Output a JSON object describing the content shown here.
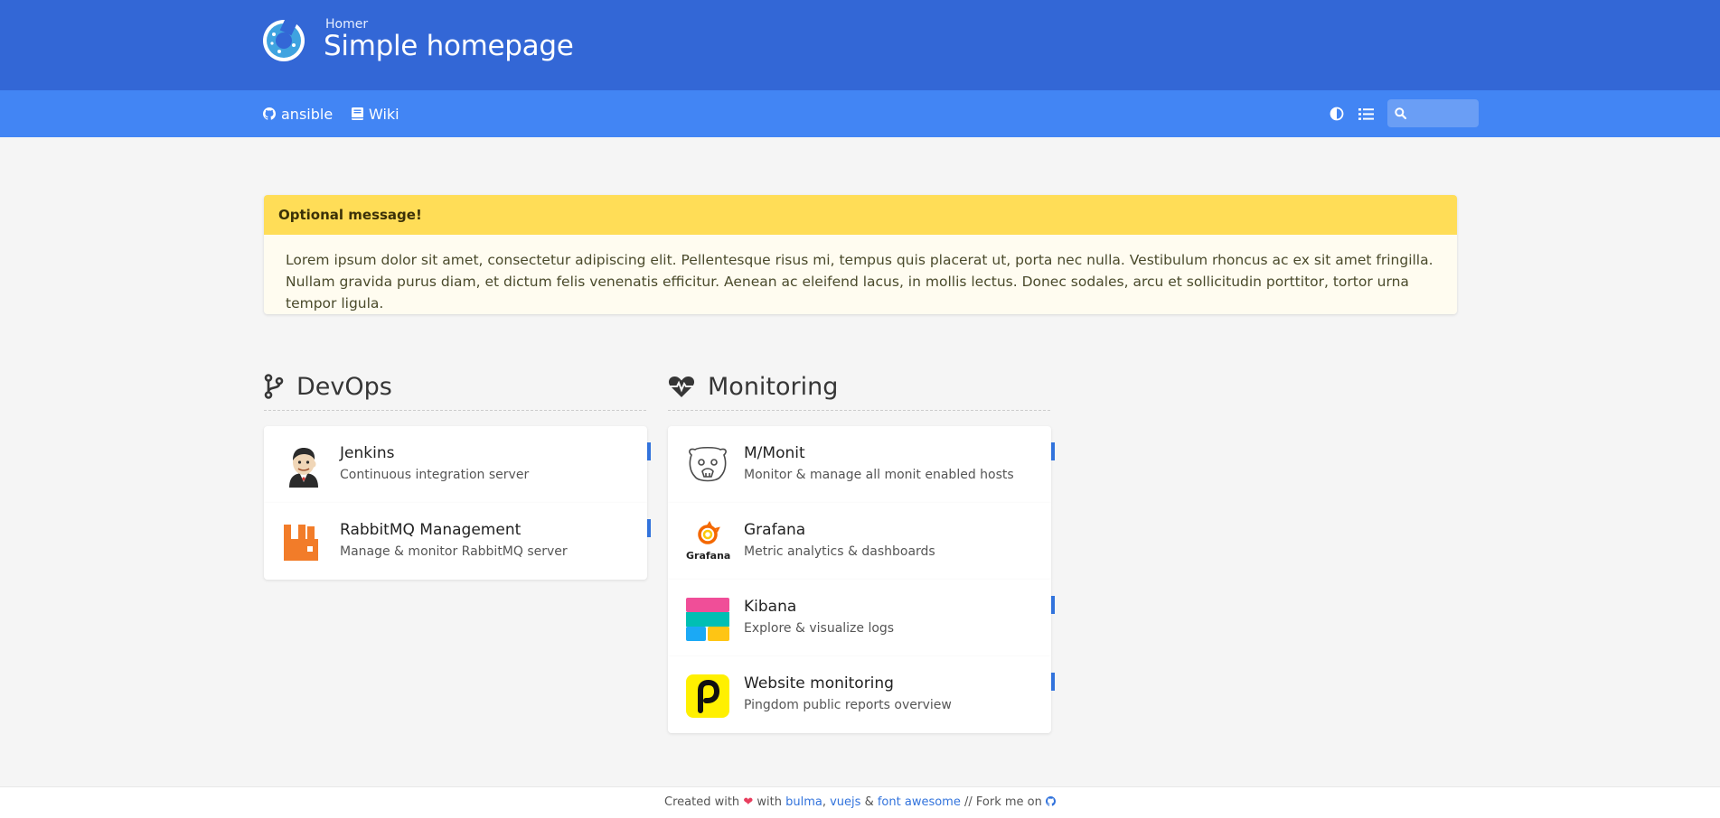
{
  "header": {
    "subtitle": "Homer",
    "title": "Simple homepage"
  },
  "navbar": {
    "links": [
      {
        "label": "ansible",
        "icon": "github-icon"
      },
      {
        "label": "Wiki",
        "icon": "book-icon"
      }
    ],
    "tools": {
      "theme_icon": "contrast-icon",
      "layout_icon": "list-icon"
    },
    "search": {
      "icon": "search-icon",
      "value": "",
      "placeholder": ""
    }
  },
  "message": {
    "title": "Optional message!",
    "body": "Lorem ipsum dolor sit amet, consectetur adipiscing elit. Pellentesque risus mi, tempus quis placerat ut, porta nec nulla. Vestibulum rhoncus ac ex sit amet fringilla. Nullam gravida purus diam, et dictum felis venenatis efficitur. Aenean ac eleifend lacus, in mollis lectus. Donec sodales, arcu et sollicitudin porttitor, tortor urna tempor ligula."
  },
  "groups": [
    {
      "name": "DevOps",
      "icon": "code-branch-icon",
      "items": [
        {
          "name": "Jenkins",
          "subtitle": "Continuous integration server",
          "icon": "jenkins-logo-icon"
        },
        {
          "name": "RabbitMQ Management",
          "subtitle": "Manage & monitor RabbitMQ server",
          "icon": "rabbitmq-logo-icon"
        }
      ]
    },
    {
      "name": "Monitoring",
      "icon": "heartbeat-icon",
      "items": [
        {
          "name": "M/Monit",
          "subtitle": "Monitor & manage all monit enabled hosts",
          "icon": "mmonit-logo-icon"
        },
        {
          "name": "Grafana",
          "subtitle": "Metric analytics & dashboards",
          "icon": "grafana-logo-icon",
          "logo_text": "Grafana"
        },
        {
          "name": "Kibana",
          "subtitle": "Explore & visualize logs",
          "icon": "kibana-logo-icon"
        },
        {
          "name": "Website monitoring",
          "subtitle": "Pingdom public reports overview",
          "icon": "pingdom-logo-icon"
        }
      ]
    }
  ],
  "footer": {
    "created_with": "Created with",
    "heart": "❤",
    "with": "with",
    "bulma": "bulma",
    "comma": ",",
    "vuejs": "vuejs",
    "amp": "&",
    "fontawesome": "font awesome",
    "fork": "// Fork me on",
    "fork_icon": "github-icon"
  },
  "colors": {
    "header": "#3367d6",
    "navbar": "#4285f4",
    "message_header": "#ffdd57",
    "message_body": "#fffcf0",
    "tag": "#3273dc",
    "background": "#f5f5f5"
  }
}
